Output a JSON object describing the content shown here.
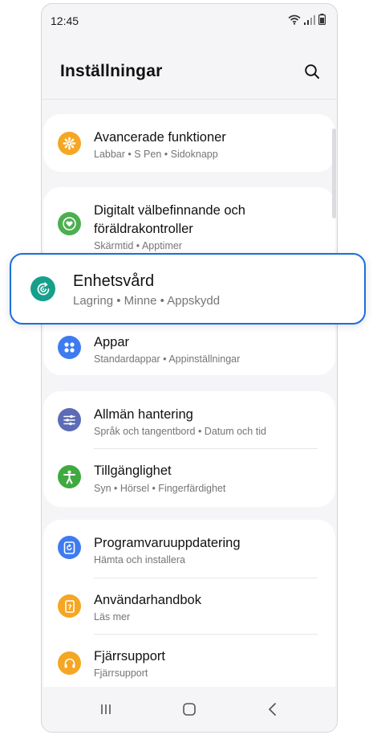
{
  "status": {
    "time": "12:45"
  },
  "header": {
    "title": "Inställningar"
  },
  "cards": {
    "advanced": {
      "title": "Avancerade funktioner",
      "subtitle": "Labbar  •  S Pen  •  Sidoknapp"
    },
    "wellbeing": {
      "title_line1": "Digitalt välbefinnande och",
      "title_line2": "föräldrakontroller",
      "subtitle": "Skärmtid  •  Apptimer"
    },
    "apps": {
      "title": "Appar",
      "subtitle": "Standardappar  •  Appinställningar"
    },
    "general": {
      "title": "Allmän hantering",
      "subtitle": "Språk och tangentbord  •  Datum och tid"
    },
    "accessibility": {
      "title": "Tillgänglighet",
      "subtitle": "Syn  •  Hörsel  •  Fingerfärdighet"
    },
    "software_update": {
      "title": "Programvaruuppdatering",
      "subtitle": "Hämta och installera"
    },
    "user_manual": {
      "title": "Användarhandbok",
      "subtitle": "Läs mer"
    },
    "remote_support": {
      "title": "Fjärrsupport",
      "subtitle": "Fjärrsupport"
    }
  },
  "highlight": {
    "title": "Enhetsvård",
    "subtitle": "Lagring  •  Minne  •  Appskydd"
  },
  "colors": {
    "advanced": "#f5a623",
    "wellbeing": "#4caf50",
    "device_care": "#16a08c",
    "apps": "#3e7bf0",
    "general": "#5c6bb5",
    "accessibility": "#3faa3f",
    "software_update": "#3e7bf0",
    "user_manual": "#f5a623",
    "remote_support": "#f5a623",
    "highlight_border": "#1a6fdb"
  },
  "icons": {
    "status": [
      "wifi-icon",
      "signal-icon",
      "battery-icon"
    ],
    "search": "search-icon",
    "nav": [
      "recent-apps-icon",
      "home-icon",
      "back-icon"
    ]
  }
}
